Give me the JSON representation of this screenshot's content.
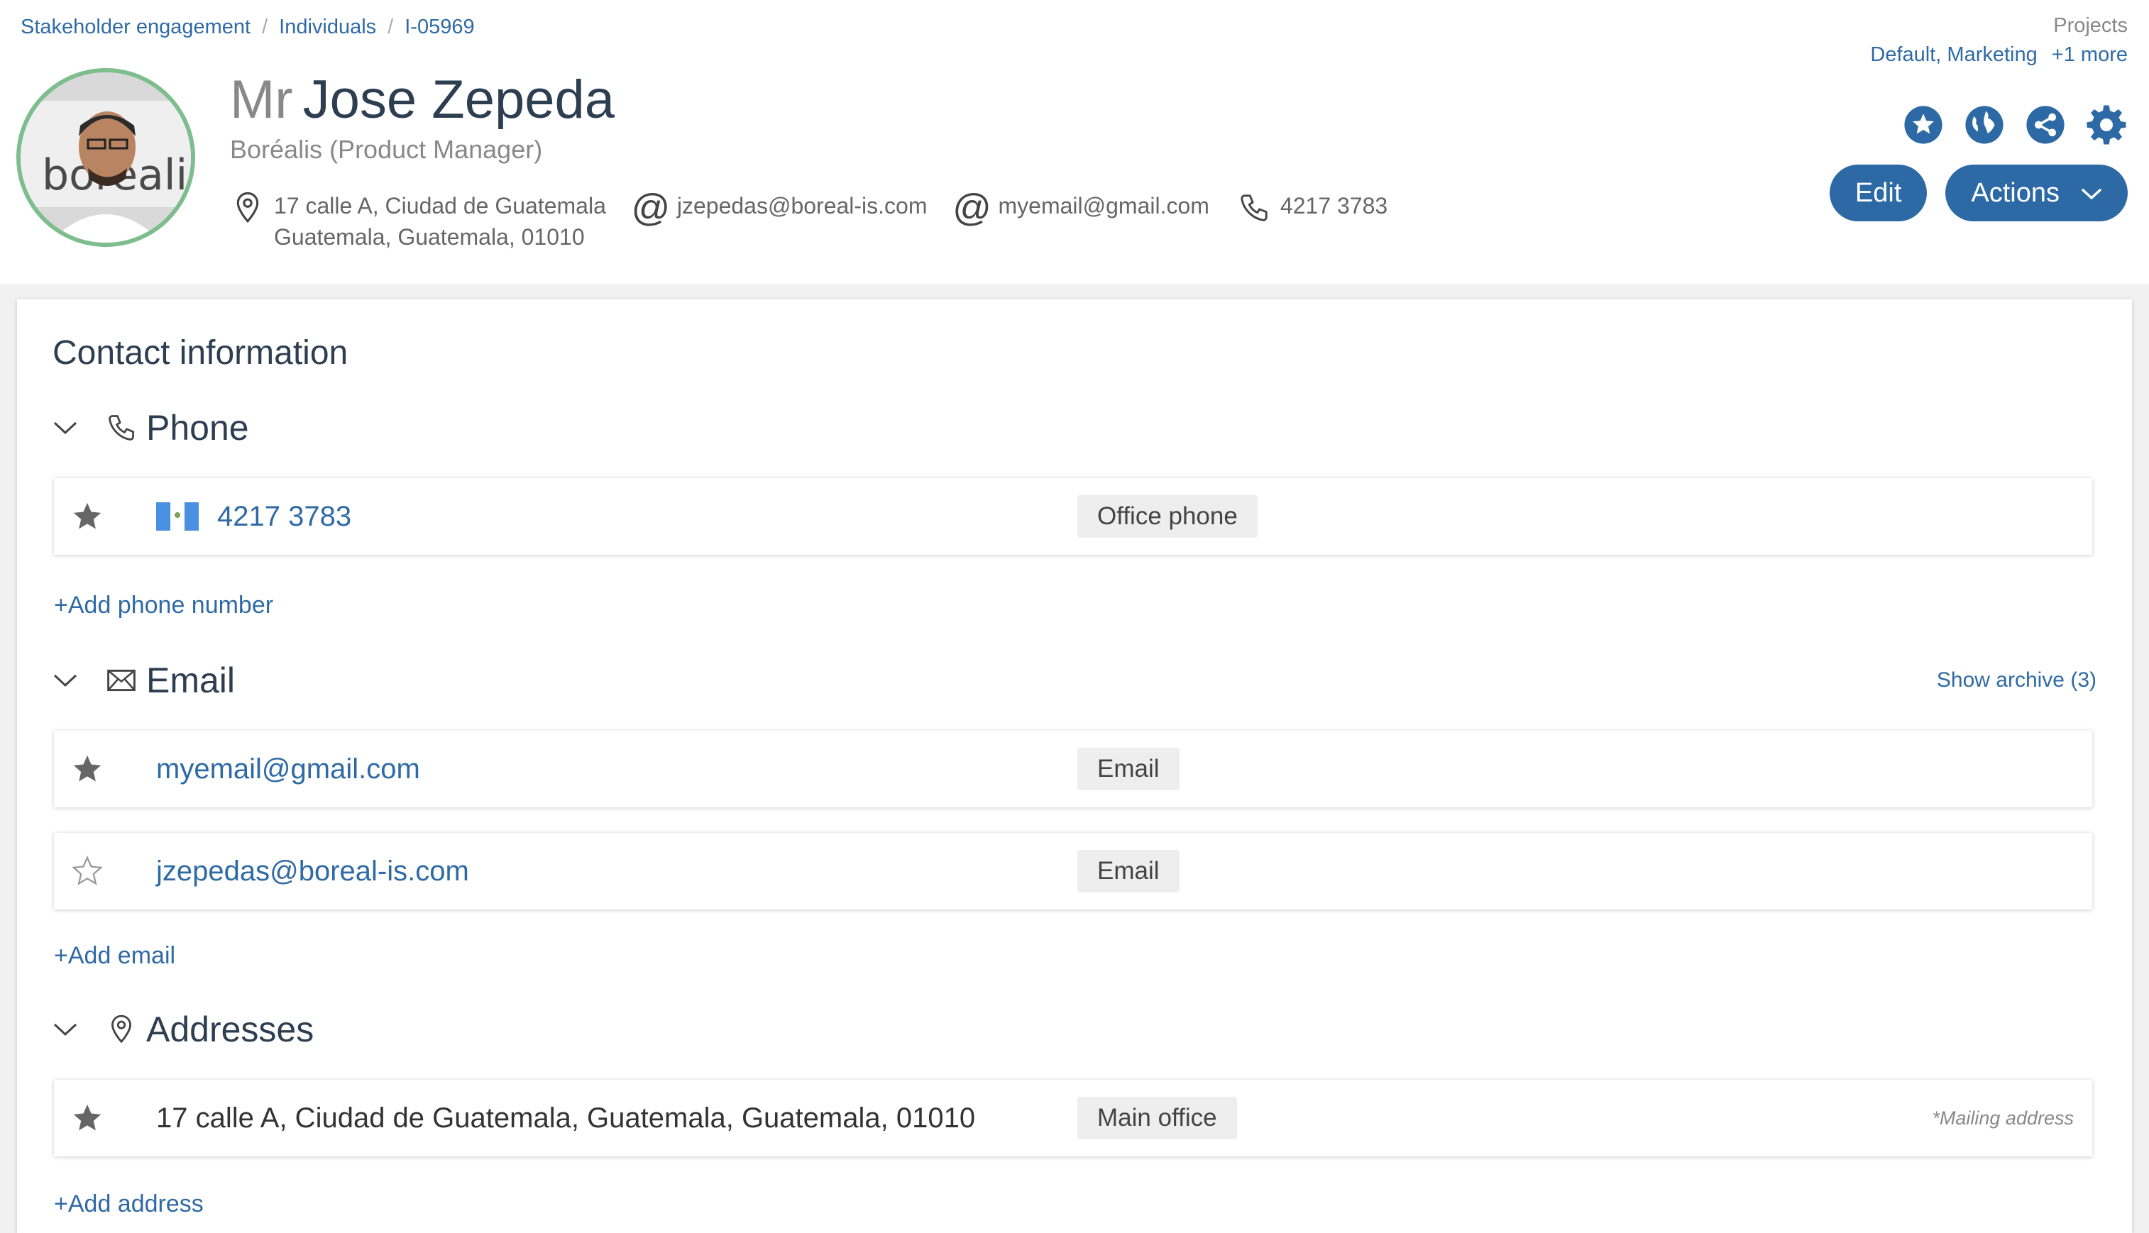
{
  "breadcrumb": [
    "Stakeholder engagement",
    "Individuals",
    "I-05969"
  ],
  "projects": {
    "label": "Projects",
    "values": "Default, Marketing",
    "more": "+1 more"
  },
  "profile": {
    "salutation": "Mr",
    "name": "Jose Zepeda",
    "org": "Boréalis (Product Manager)",
    "address_line1": "17 calle A, Ciudad de Guatemala",
    "address_line2": "Guatemala, Guatemala, 01010",
    "email1": "jzepedas@boreal-is.com",
    "email2": "myemail@gmail.com",
    "phone": "4217 3783",
    "avatar_text": "boréalis"
  },
  "buttons": {
    "edit": "Edit",
    "actions": "Actions"
  },
  "card": {
    "title": "Contact information",
    "phone_section": {
      "title": "Phone",
      "items": [
        {
          "value": "4217 3783",
          "tag": "Office phone",
          "primary": true
        }
      ],
      "add": "Add phone number"
    },
    "email_section": {
      "title": "Email",
      "show_archive": "Show archive (3)",
      "items": [
        {
          "value": "myemail@gmail.com",
          "tag": "Email",
          "primary": true
        },
        {
          "value": "jzepedas@boreal-is.com",
          "tag": "Email",
          "primary": false
        }
      ],
      "add": "Add email"
    },
    "address_section": {
      "title": "Addresses",
      "items": [
        {
          "value": "17 calle A, Ciudad de Guatemala, Guatemala, Guatemala, 01010",
          "tag": "Main office",
          "note": "*Mailing address",
          "primary": true
        }
      ],
      "add": "Add address"
    }
  },
  "colors": {
    "accent": "#2d6aa5",
    "avatar_ring": "#7dbd8e",
    "flag_blue": "#4a90e2"
  },
  "icons": [
    "location-pin-icon",
    "at-icon",
    "phone-icon",
    "star-icon",
    "globe-icon",
    "share-icon",
    "gear-icon",
    "chevron-down-icon",
    "envelope-icon"
  ]
}
